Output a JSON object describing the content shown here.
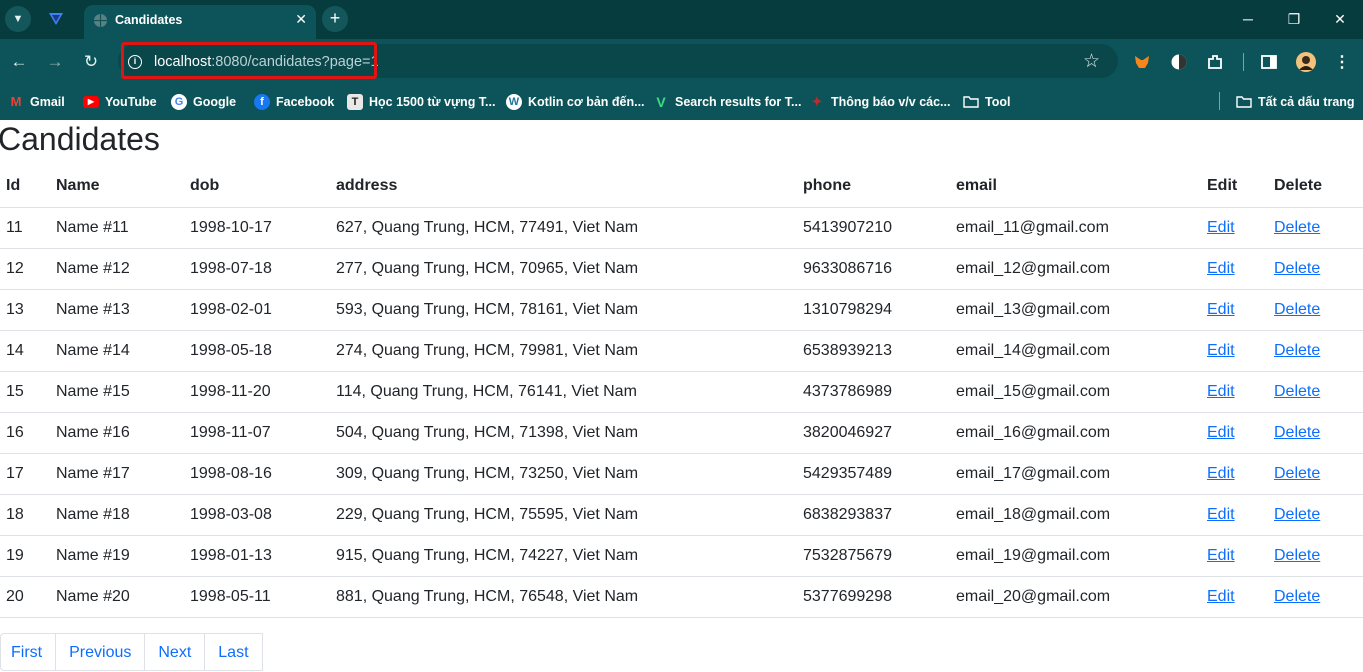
{
  "browser": {
    "tab_title": "Candidates",
    "tab_close": "✕",
    "new_tab": "+",
    "url_host": "localhost",
    "url_rest": ":8080/candidates?page=1",
    "window": {
      "minimize": "─",
      "maximize": "❐",
      "close": "✕"
    },
    "bookmarks": [
      {
        "label": "Gmail",
        "icon": "gmail-icon",
        "color": "#ea4335"
      },
      {
        "label": "YouTube",
        "icon": "youtube-icon",
        "color": "#ff0000"
      },
      {
        "label": "Google",
        "icon": "google-icon",
        "color": "#ffffff"
      },
      {
        "label": "Facebook",
        "icon": "facebook-icon",
        "color": "#1877f2"
      },
      {
        "label": "Học 1500 từ vựng T...",
        "icon": "t-icon",
        "color": "#e8e8e8"
      },
      {
        "label": "Kotlin cơ bản đến...",
        "icon": "wordpress-icon",
        "color": "#21759b"
      },
      {
        "label": "Search results for T...",
        "icon": "v-icon",
        "color": "#3ddc84"
      },
      {
        "label": "Thông báo v/v các...",
        "icon": "bird-icon",
        "color": "#c62828"
      },
      {
        "label": "Tool",
        "icon": "folder-icon",
        "color": "#ffffff"
      }
    ],
    "all_bookmarks": "Tất cả dấu trang"
  },
  "page": {
    "title": "Candidates",
    "columns": [
      "Id",
      "Name",
      "dob",
      "address",
      "phone",
      "email",
      "Edit",
      "Delete"
    ],
    "rows": [
      {
        "id": "11",
        "name": "Name #11",
        "dob": "1998-10-17",
        "address": "627, Quang Trung, HCM, 77491, Viet Nam",
        "phone": "5413907210",
        "email": "email_11@gmail.com",
        "edit": "Edit",
        "delete": "Delete"
      },
      {
        "id": "12",
        "name": "Name #12",
        "dob": "1998-07-18",
        "address": "277, Quang Trung, HCM, 70965, Viet Nam",
        "phone": "9633086716",
        "email": "email_12@gmail.com",
        "edit": "Edit",
        "delete": "Delete"
      },
      {
        "id": "13",
        "name": "Name #13",
        "dob": "1998-02-01",
        "address": "593, Quang Trung, HCM, 78161, Viet Nam",
        "phone": "1310798294",
        "email": "email_13@gmail.com",
        "edit": "Edit",
        "delete": "Delete"
      },
      {
        "id": "14",
        "name": "Name #14",
        "dob": "1998-05-18",
        "address": "274, Quang Trung, HCM, 79981, Viet Nam",
        "phone": "6538939213",
        "email": "email_14@gmail.com",
        "edit": "Edit",
        "delete": "Delete"
      },
      {
        "id": "15",
        "name": "Name #15",
        "dob": "1998-11-20",
        "address": "114, Quang Trung, HCM, 76141, Viet Nam",
        "phone": "4373786989",
        "email": "email_15@gmail.com",
        "edit": "Edit",
        "delete": "Delete"
      },
      {
        "id": "16",
        "name": "Name #16",
        "dob": "1998-11-07",
        "address": "504, Quang Trung, HCM, 71398, Viet Nam",
        "phone": "3820046927",
        "email": "email_16@gmail.com",
        "edit": "Edit",
        "delete": "Delete"
      },
      {
        "id": "17",
        "name": "Name #17",
        "dob": "1998-08-16",
        "address": "309, Quang Trung, HCM, 73250, Viet Nam",
        "phone": "5429357489",
        "email": "email_17@gmail.com",
        "edit": "Edit",
        "delete": "Delete"
      },
      {
        "id": "18",
        "name": "Name #18",
        "dob": "1998-03-08",
        "address": "229, Quang Trung, HCM, 75595, Viet Nam",
        "phone": "6838293837",
        "email": "email_18@gmail.com",
        "edit": "Edit",
        "delete": "Delete"
      },
      {
        "id": "19",
        "name": "Name #19",
        "dob": "1998-01-13",
        "address": "915, Quang Trung, HCM, 74227, Viet Nam",
        "phone": "7532875679",
        "email": "email_19@gmail.com",
        "edit": "Edit",
        "delete": "Delete"
      },
      {
        "id": "20",
        "name": "Name #20",
        "dob": "1998-05-11",
        "address": "881, Quang Trung, HCM, 76548, Viet Nam",
        "phone": "5377699298",
        "email": "email_20@gmail.com",
        "edit": "Edit",
        "delete": "Delete"
      }
    ],
    "pagination": [
      "First",
      "Previous",
      "Next",
      "Last"
    ]
  },
  "colors": {
    "chrome_dark": "#073c3f",
    "chrome": "#0c5459",
    "link": "#0d6efd",
    "highlight": "#e11414"
  }
}
